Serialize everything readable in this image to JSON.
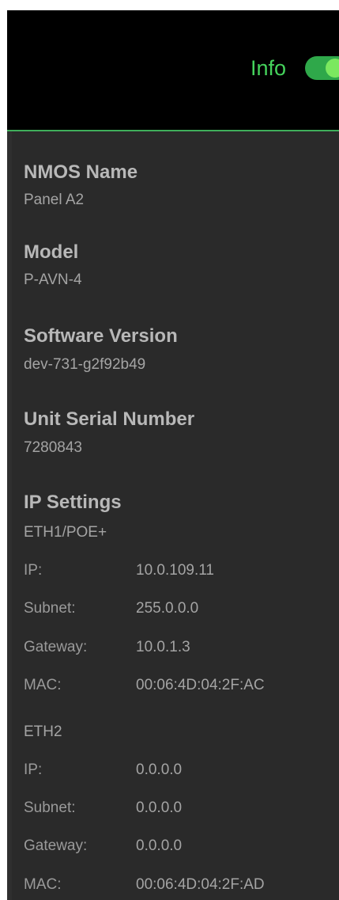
{
  "header": {
    "title": "Info",
    "toggle_on": true,
    "accent_color": "#45d35c"
  },
  "fields": {
    "nmos_name_label": "NMOS Name",
    "nmos_name_value": "Panel A2",
    "model_label": "Model",
    "model_value": "P-AVN-4",
    "software_label": "Software Version",
    "software_value": "dev-731-g2f92b49",
    "serial_label": "Unit Serial Number",
    "serial_value": "7280843"
  },
  "ip": {
    "label": "IP Settings",
    "eth1": {
      "title": "ETH1/POE+",
      "ip_key": "IP:",
      "ip": "10.0.109.11",
      "subnet_key": "Subnet:",
      "subnet": "255.0.0.0",
      "gateway_key": "Gateway:",
      "gateway": "10.0.1.3",
      "mac_key": "MAC:",
      "mac": "00:06:4D:04:2F:AC"
    },
    "eth2": {
      "title": "ETH2",
      "ip_key": "IP:",
      "ip": "0.0.0.0",
      "subnet_key": "Subnet:",
      "subnet": "0.0.0.0",
      "gateway_key": "Gateway:",
      "gateway": "0.0.0.0",
      "mac_key": "MAC:",
      "mac": "00:06:4D:04:2F:AD"
    }
  }
}
